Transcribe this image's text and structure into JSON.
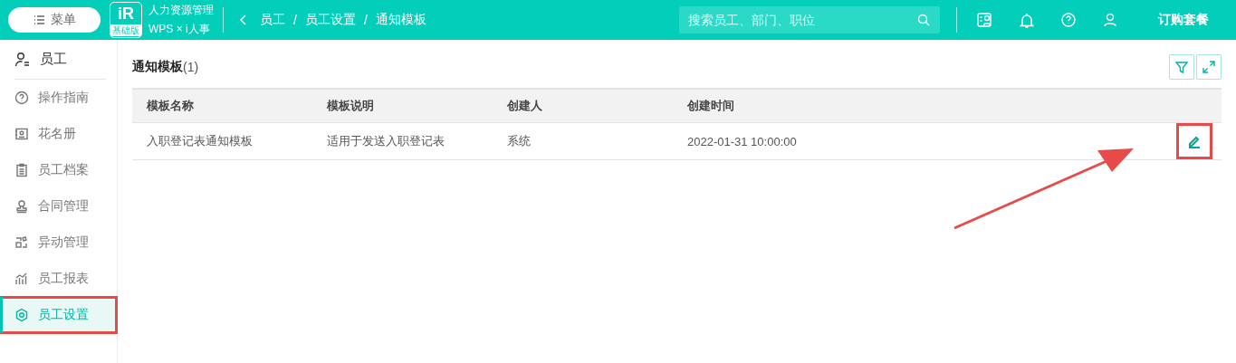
{
  "header": {
    "menu_button": "菜单",
    "logo": {
      "mark": "iR",
      "edition": "基础版"
    },
    "product": {
      "name": "人力资源管理",
      "subtitle": "WPS × i人事"
    },
    "breadcrumb": [
      "员工",
      "员工设置",
      "通知模板"
    ],
    "breadcrumb_separator": "/",
    "search": {
      "placeholder": "搜索员工、部门、职位"
    },
    "subscribe": "订购套餐"
  },
  "sidebar": {
    "title": "员工",
    "items": [
      {
        "label": "操作指南",
        "kind": "help",
        "selected": false,
        "highlighted": false
      },
      {
        "label": "花名册",
        "kind": "roster",
        "selected": false,
        "highlighted": false
      },
      {
        "label": "员工档案",
        "kind": "file",
        "selected": false,
        "highlighted": false
      },
      {
        "label": "合同管理",
        "kind": "stamp",
        "selected": false,
        "highlighted": false
      },
      {
        "label": "异动管理",
        "kind": "blocks",
        "selected": false,
        "highlighted": false
      },
      {
        "label": "员工报表",
        "kind": "chart",
        "selected": false,
        "highlighted": false
      },
      {
        "label": "员工设置",
        "kind": "gear",
        "selected": true,
        "highlighted": true
      }
    ]
  },
  "content": {
    "title": "通知模板",
    "count": "(1)",
    "table": {
      "columns": [
        "模板名称",
        "模板说明",
        "创建人",
        "创建时间"
      ],
      "rows": [
        {
          "cells": [
            "入职登记表通知模板",
            "适用于发送入职登记表",
            "系统",
            "2022-01-31 10:00:00"
          ],
          "action_highlighted": true
        }
      ]
    },
    "pointer_arrow": true
  }
}
